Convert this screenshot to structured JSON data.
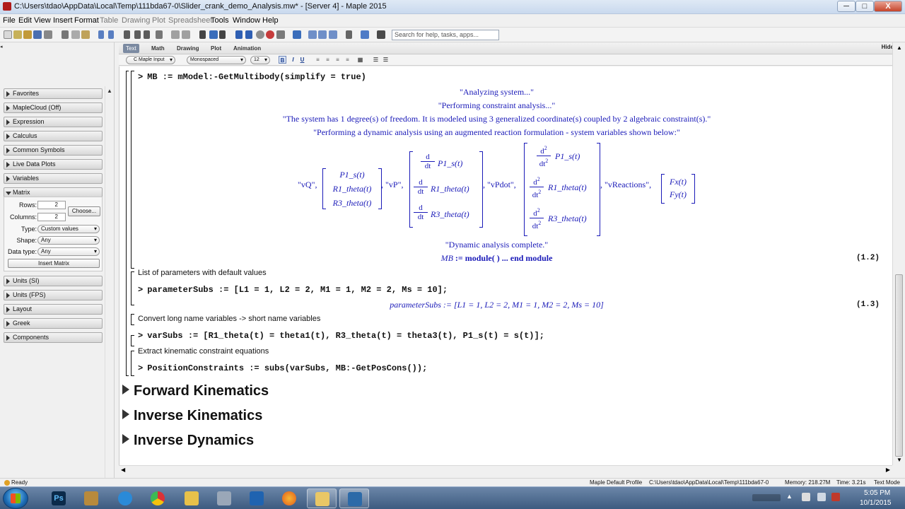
{
  "window": {
    "title": "C:\\Users\\tdao\\AppData\\Local\\Temp\\111bda67-0\\Slider_crank_demo_Analysis.mw* - [Server 4] - Maple 2015",
    "min": "─",
    "max": "□",
    "close": "X"
  },
  "menu": [
    "File",
    "Edit",
    "View",
    "Insert",
    "Format",
    "Table",
    "Drawing",
    "Plot",
    "Spreadsheet",
    "Tools",
    "Window",
    "Help"
  ],
  "search": {
    "placeholder": "Search for help, tasks, apps..."
  },
  "palettes": {
    "headers": [
      "Favorites",
      "MapleCloud (Off)",
      "Expression",
      "Calculus",
      "Common Symbols",
      "Live Data Plots",
      "Variables",
      "Matrix",
      "Units (SI)",
      "Units (FPS)",
      "Layout",
      "Greek",
      "Components"
    ],
    "matrix": {
      "rows_label": "Rows:",
      "rows": "2",
      "cols_label": "Columns:",
      "cols": "2",
      "choose": "Choose...",
      "type_label": "Type:",
      "type": "Custom values",
      "shape_label": "Shape:",
      "shape": "Any",
      "dtype_label": "Data type:",
      "dtype": "Any",
      "insert": "Insert Matrix"
    }
  },
  "tabs": [
    "Text",
    "Math",
    "Drawing",
    "Plot",
    "Animation"
  ],
  "hide": "Hide",
  "format": {
    "style": "C Maple Input",
    "font": "Monospaced",
    "size": "12",
    "bold": "B",
    "italic": "I",
    "underline": "U"
  },
  "doc": {
    "in1": "MB := mModel:-GetMultibody(simplify = true)",
    "out_analyzing": "\"Analyzing system...\"",
    "out_constraint": "\"Performing constraint analysis...\"",
    "out_dof": "\"The system has 1 degree(s) of freedom.  It is modeled using 3 generalized coordinate(s) coupled by 2 algebraic constraint(s).\"",
    "out_dynamic": "\"Performing a dynamic analysis using an augmented reaction formulation - system variables shown below:\"",
    "m_vQ": "\"vQ\",",
    "vQ": [
      "P1_s(t)",
      "R1_theta(t)",
      "R3_theta(t)"
    ],
    "m_vP": ", \"vP\",",
    "vP": [
      "P1_s(t)",
      "R1_theta(t)",
      "R3_theta(t)"
    ],
    "m_vPdot": ", \"vPdot\",",
    "vPdot": [
      "P1_s(t)",
      "R1_theta(t)",
      "R3_theta(t)"
    ],
    "m_vR": ", \"vReactions\",",
    "vR": [
      "Fx(t)",
      "Fy(t)"
    ],
    "d": "d",
    "dt": "dt",
    "d2": "2",
    "out_complete": "\"Dynamic analysis complete.\"",
    "out_module_a": "MB",
    "out_module_b": " := module( )  ...  end module",
    "lbl12": "(1.2)",
    "t_params": "List of parameters with default values",
    "in2": "parameterSubs := [L1 = 1, L2 = 2, M1 = 1, M2 = 2, Ms = 10];",
    "out_params": "parameterSubs := [L1 = 1, L2 = 2, M1 = 1, M2 = 2, Ms = 10]",
    "lbl13": "(1.3)",
    "t_convert": "Convert long name variables -> short name variables",
    "in3": "varSubs := [R1_theta(t) = theta1(t), R3_theta(t) = theta3(t), P1_s(t) = s(t)];",
    "t_extract": "Extract kinematic constraint equations",
    "in4": "PositionConstraints := subs(varSubs, MB:-GetPosCons());",
    "prompt": ">",
    "sections": [
      "Forward Kinematics",
      "Inverse Kinematics",
      "Inverse Dynamics"
    ]
  },
  "status": {
    "ready": "Ready",
    "profile": "Maple Default Profile",
    "path": "C:\\Users\\tdao\\AppData\\Local\\Temp\\111bda67-0",
    "memory": "Memory: 218.27M",
    "time": "Time: 3.21s",
    "mode": "Text Mode"
  },
  "taskbar": {
    "time": "5:05 PM",
    "date": "10/1/2015"
  }
}
